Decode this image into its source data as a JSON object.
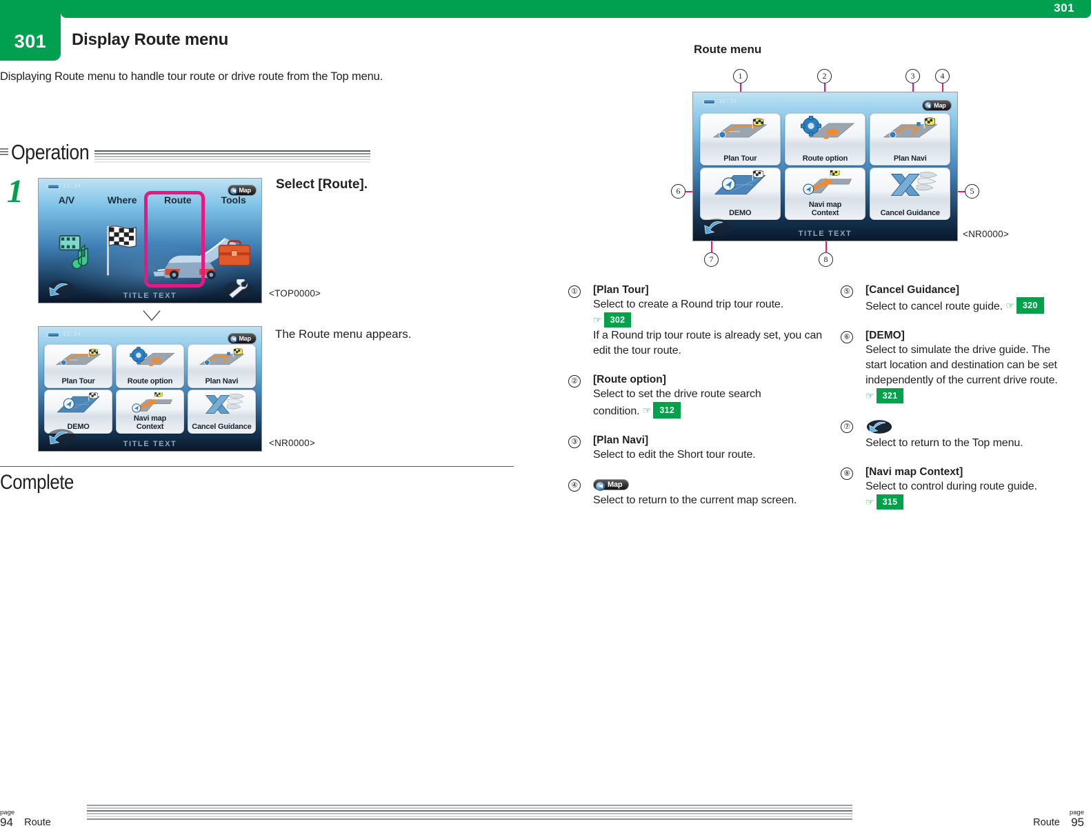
{
  "header": {
    "chapter_number": "301",
    "corner_page_number": "301",
    "title": "Display Route menu",
    "intro": "Displaying Route menu to handle tour route or drive route from the Top menu."
  },
  "operation": {
    "section_label": "Operation",
    "step_number": "1",
    "step_instruction": "Select [Route].",
    "result_text": "The Route menu appears.",
    "top_screen_code": "<TOP0000>",
    "route_screen_code": "<NR0000>",
    "complete_label": "Complete"
  },
  "top_menu_screen": {
    "clock": "12:34",
    "map_button": "Map",
    "title_text": "TITLE TEXT",
    "items": [
      "A/V",
      "Where",
      "Route",
      "Tools"
    ],
    "highlighted": "Route"
  },
  "route_menu_screen": {
    "clock": "12:34",
    "map_button": "Map",
    "title_text": "TITLE TEXT",
    "tiles": [
      {
        "label": "Plan Tour",
        "icon": "route-tour-icon"
      },
      {
        "label": "Route option",
        "icon": "gear-route-icon"
      },
      {
        "label": "Plan Navi",
        "icon": "route-navi-icon"
      },
      {
        "label": "DEMO",
        "icon": "demo-compass-icon"
      },
      {
        "label": "Navi map\nContext",
        "icon": "navi-map-context-icon"
      },
      {
        "label": "Cancel Guidance",
        "icon": "cancel-guidance-icon"
      }
    ]
  },
  "figure": {
    "title": "Route menu",
    "screen_code": "<NR0000>",
    "callouts": [
      "1",
      "2",
      "3",
      "4",
      "5",
      "6",
      "7",
      "8"
    ]
  },
  "descriptions": {
    "left": [
      {
        "marker": "①",
        "title": "[Plan Tour]",
        "lines": [
          "Select to create a Round trip tour route."
        ],
        "pgref": "302",
        "extra": "If a Round trip tour route is already set, you can edit the tour route."
      },
      {
        "marker": "②",
        "title": "[Route option]",
        "lines": [
          "Select to set the drive route search",
          "condition."
        ],
        "pgref": "312",
        "extra": ""
      },
      {
        "marker": "③",
        "title": "[Plan Navi]",
        "lines": [
          "Select to edit the Short tour route."
        ],
        "pgref": "",
        "extra": ""
      },
      {
        "marker": "④",
        "title": "Map",
        "title_is_icon": "map-button-icon",
        "lines": [
          "Select to return to the current map screen."
        ],
        "pgref": "",
        "extra": ""
      }
    ],
    "right": [
      {
        "marker": "⑤",
        "title": "[Cancel Guidance]",
        "lines": [
          "Select to cancel route guide."
        ],
        "pgref": "320",
        "extra": ""
      },
      {
        "marker": "⑥",
        "title": "[DEMO]",
        "lines": [
          "Select to simulate the drive guide. The",
          "start location and destination can be set",
          "independently of the current drive route."
        ],
        "pgref": "321",
        "extra": ""
      },
      {
        "marker": "⑦",
        "title": "",
        "title_is_icon": "back-arrow-icon",
        "lines": [
          "Select to return to the Top menu."
        ],
        "pgref": "",
        "extra": ""
      },
      {
        "marker": "⑧",
        "title": "[Navi map Context]",
        "lines": [
          "Select to control during route guide."
        ],
        "pgref": "315",
        "extra": ""
      }
    ]
  },
  "footer": {
    "left_page_label": "page",
    "left_page_number": "94",
    "left_section": "Route",
    "right_section": "Route",
    "right_page_label": "page",
    "right_page_number": "95"
  },
  "colors": {
    "brand_green": "#00a050",
    "ref_green": "#00a14b",
    "highlight_magenta": "#e5197f",
    "text": "#231f20"
  }
}
